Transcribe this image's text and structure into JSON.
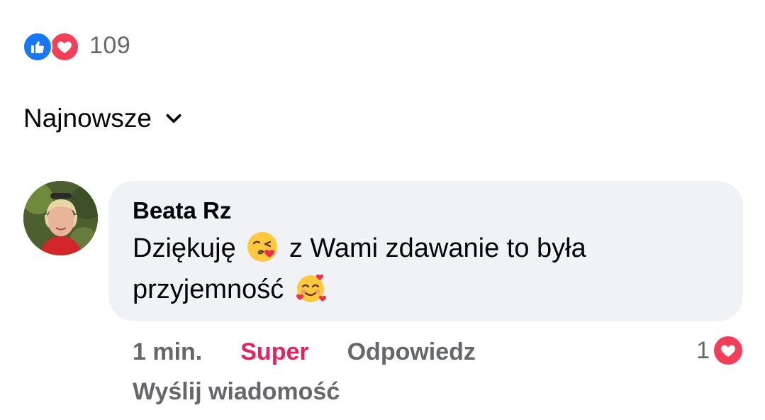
{
  "post_reactions": {
    "icons": [
      "like-icon",
      "love-icon"
    ],
    "count": "109",
    "colors": {
      "like": "#1877f2",
      "love": "#f33e58"
    }
  },
  "sort": {
    "label": "Najnowsze",
    "icon": "chevron-down-icon"
  },
  "comment": {
    "author": "Beata Rz",
    "text_part1": "Dziękuję",
    "emoji1": "kissing-heart-emoji",
    "text_part2": "z Wami zdawanie to była",
    "text_part3": "przyjemność",
    "emoji2": "smiling-hearts-emoji",
    "timestamp": "1 min.",
    "reaction_label": "Super",
    "reply_label": "Odpowiedz",
    "send_message_label": "Wyślij wiadomość",
    "reaction_count": "1",
    "reaction_icon": "love-icon",
    "colors": {
      "bubble": "#f0f2f5",
      "super": "#e0245e",
      "secondary": "#65676b"
    }
  }
}
